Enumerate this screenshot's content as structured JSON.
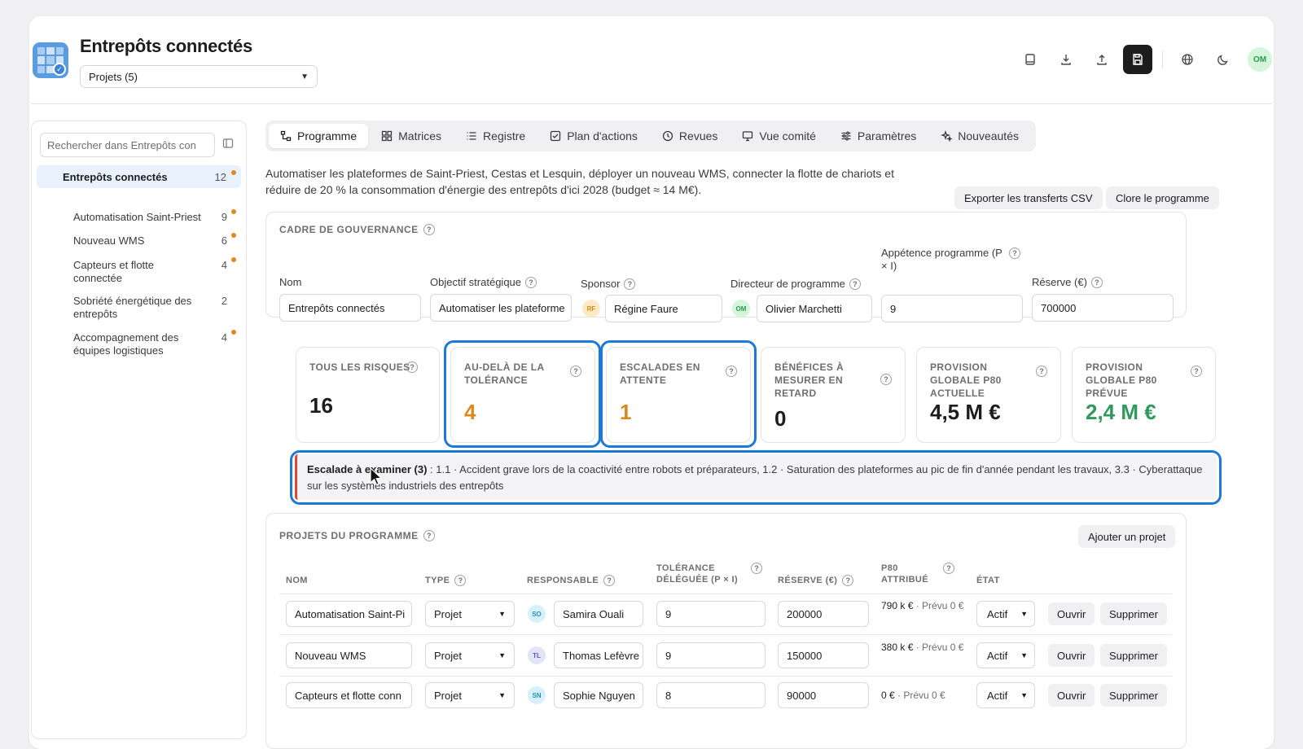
{
  "header": {
    "title": "Entrepôts connectés",
    "project_select": "Projets (5)",
    "user_initials": "OM"
  },
  "sidebar": {
    "search_placeholder": "Rechercher dans Entrepôts con",
    "root": {
      "label": "Entrepôts connectés",
      "count": "12"
    },
    "items": [
      {
        "label": "Automatisation Saint-Priest",
        "count": "9",
        "flag": true
      },
      {
        "label": "Nouveau WMS",
        "count": "6",
        "flag": true
      },
      {
        "label": "Capteurs et flotte connectée",
        "count": "4",
        "flag": true
      },
      {
        "label": "Sobriété énergétique des entrepôts",
        "count": "2",
        "flag": false
      },
      {
        "label": "Accompagnement des équipes logistiques",
        "count": "4",
        "flag": true
      }
    ]
  },
  "tabs": [
    "Programme",
    "Matrices",
    "Registre",
    "Plan d'actions",
    "Revues",
    "Vue comité",
    "Paramètres",
    "Nouveautés"
  ],
  "description": "Automatiser les plateformes de Saint-Priest, Cestas et Lesquin, déployer un nouveau WMS, connecter la flotte de chariots et réduire de 20 % la consommation d'énergie des entrepôts d'ici 2028 (budget ≈ 14 M€).",
  "actions": {
    "export": "Exporter les transferts CSV",
    "close": "Clore le programme"
  },
  "governance": {
    "title": "CADRE DE GOUVERNANCE",
    "labels": {
      "name": "Nom",
      "objective": "Objectif stratégique",
      "sponsor": "Sponsor",
      "director": "Directeur de programme",
      "appetite": "Appétence programme (P × I)",
      "reserve": "Réserve (€)"
    },
    "values": {
      "name": "Entrepôts connectés",
      "objective": "Automatiser les plateforme",
      "sponsor_initials": "RF",
      "sponsor": "Régine Faure",
      "director_initials": "OM",
      "director": "Olivier Marchetti",
      "appetite": "9",
      "reserve": "700000"
    }
  },
  "kpis": [
    {
      "title": "TOUS LES RISQUES",
      "value": "16",
      "color": "#1d1d1f"
    },
    {
      "title": "AU-DELÀ DE LA TOLÉRANCE",
      "value": "4",
      "color": "#d98a1c"
    },
    {
      "title": "ESCALADES EN ATTENTE",
      "value": "1",
      "color": "#d98a1c"
    },
    {
      "title": "BÉNÉFICES À MESURER EN RETARD",
      "value": "0",
      "color": "#1d1d1f"
    },
    {
      "title": "PROVISION GLOBALE P80 ACTUELLE",
      "value": "4,5 M €",
      "color": "#1d1d1f"
    },
    {
      "title": "PROVISION GLOBALE P80 PRÉVUE",
      "value": "2,4 M €",
      "color": "#2e9a5c"
    }
  ],
  "escalation": {
    "label": "Escalade à examiner (3)",
    "text": " : 1.1 · Accident grave lors de la coactivité entre robots et préparateurs, 1.2 · Saturation des plateformes au pic de fin d'année pendant les travaux, 3.3 · Cyberattaque sur les systèmes industriels des entrepôts"
  },
  "projects": {
    "title": "PROJETS DU PROGRAMME",
    "add_button": "Ajouter un projet",
    "columns": [
      "NOM",
      "TYPE",
      "RESPONSABLE",
      "TOLÉRANCE DÉLÉGUÉE (P × I)",
      "RÉSERVE (€)",
      "P80 ATTRIBUÉ",
      "ÉTAT"
    ],
    "open_label": "Ouvrir",
    "delete_label": "Supprimer",
    "rows": [
      {
        "name": "Automatisation Saint-Pi",
        "type": "Projet",
        "initials": "SO",
        "owner": "Samira Ouali",
        "tolerance": "9",
        "reserve": "200000",
        "p80": "790 k €",
        "p80_planned": " · Prévu 0 €",
        "state": "Actif"
      },
      {
        "name": "Nouveau WMS",
        "type": "Projet",
        "initials": "TL",
        "owner": "Thomas Lefèvre",
        "tolerance": "9",
        "reserve": "150000",
        "p80": "380 k €",
        "p80_planned": " · Prévu 0 €",
        "state": "Actif"
      },
      {
        "name": "Capteurs et flotte conn",
        "type": "Projet",
        "initials": "SN",
        "owner": "Sophie Nguyen",
        "tolerance": "8",
        "reserve": "90000",
        "p80": "0 €",
        "p80_planned": " · Prévu 0 €",
        "state": "Actif"
      }
    ]
  }
}
